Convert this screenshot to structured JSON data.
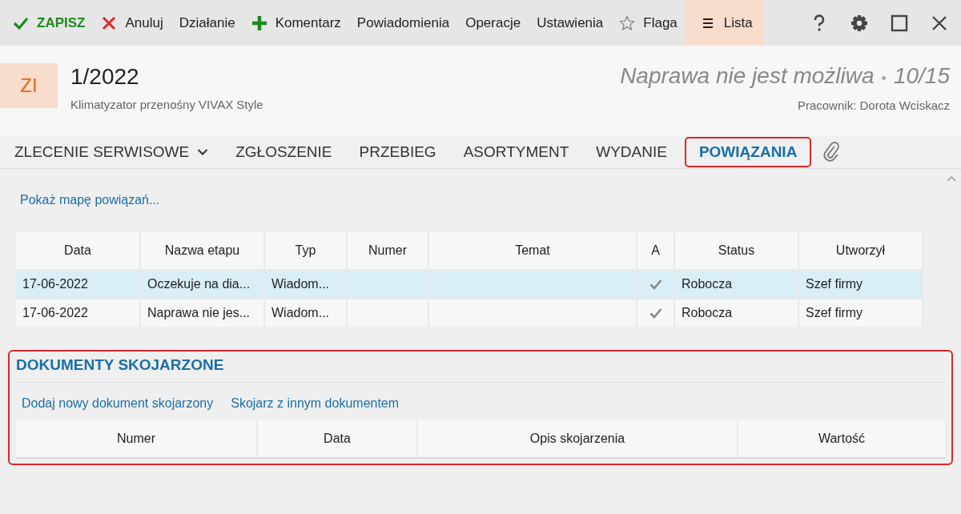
{
  "toolbar": {
    "items": [
      {
        "label": "ZAPISZ",
        "kind": "save",
        "selected": false
      },
      {
        "label": "Anuluj",
        "kind": "cancel",
        "selected": false
      },
      {
        "label": "Działanie",
        "kind": "plain",
        "selected": false
      },
      {
        "label": "Komentarz",
        "kind": "add",
        "selected": false
      },
      {
        "label": "Powiadomienia",
        "kind": "plain",
        "selected": false
      },
      {
        "label": "Operacje",
        "kind": "plain",
        "selected": false
      },
      {
        "label": "Ustawienia",
        "kind": "plain",
        "selected": false
      },
      {
        "label": "Flaga",
        "kind": "flag",
        "selected": false
      },
      {
        "label": "Lista",
        "kind": "list",
        "selected": true
      }
    ]
  },
  "header": {
    "badge": "ZI",
    "number": "1/2022",
    "subtitle": "Klimatyzator przenośny VIVAX Style",
    "status": "Naprawa nie jest możliwa",
    "separator": "•",
    "progress": "10/15",
    "employee": "Pracownik: Dorota Wciskacz"
  },
  "tabs": [
    {
      "label": "ZLECENIE SERWISOWE",
      "dropdown": true,
      "selected": false
    },
    {
      "label": "ZGŁOSZENIE",
      "dropdown": false,
      "selected": false
    },
    {
      "label": "PRZEBIEG",
      "dropdown": false,
      "selected": false
    },
    {
      "label": "ASORTYMENT",
      "dropdown": false,
      "selected": false
    },
    {
      "label": "WYDANIE",
      "dropdown": false,
      "selected": false
    },
    {
      "label": "POWIĄZANIA",
      "dropdown": false,
      "selected": true
    }
  ],
  "map_link": "Pokaż mapę powiązań...",
  "stages_table": {
    "columns": [
      "Data",
      "Nazwa etapu",
      "Typ",
      "Numer",
      "Temat",
      "A",
      "Status",
      "Utworzył"
    ],
    "rows": [
      {
        "date": "17-06-2022",
        "stage": "Oczekuje na dia...",
        "type": "Wiadom...",
        "approved": true,
        "status": "Robocza",
        "created_by": "Szef firmy",
        "selected": true
      },
      {
        "date": "17-06-2022",
        "stage": "Naprawa nie jes...",
        "type": "Wiadom...",
        "approved": true,
        "status": "Robocza",
        "created_by": "Szef firmy",
        "selected": false
      }
    ]
  },
  "linked_documents": {
    "title": "DOKUMENTY SKOJARZONE",
    "links": [
      "Dodaj nowy dokument skojarzony",
      "Skojarz z innym dokumentem"
    ],
    "columns": [
      "Numer",
      "Data",
      "Opis skojarzenia",
      "Wartość"
    ]
  }
}
